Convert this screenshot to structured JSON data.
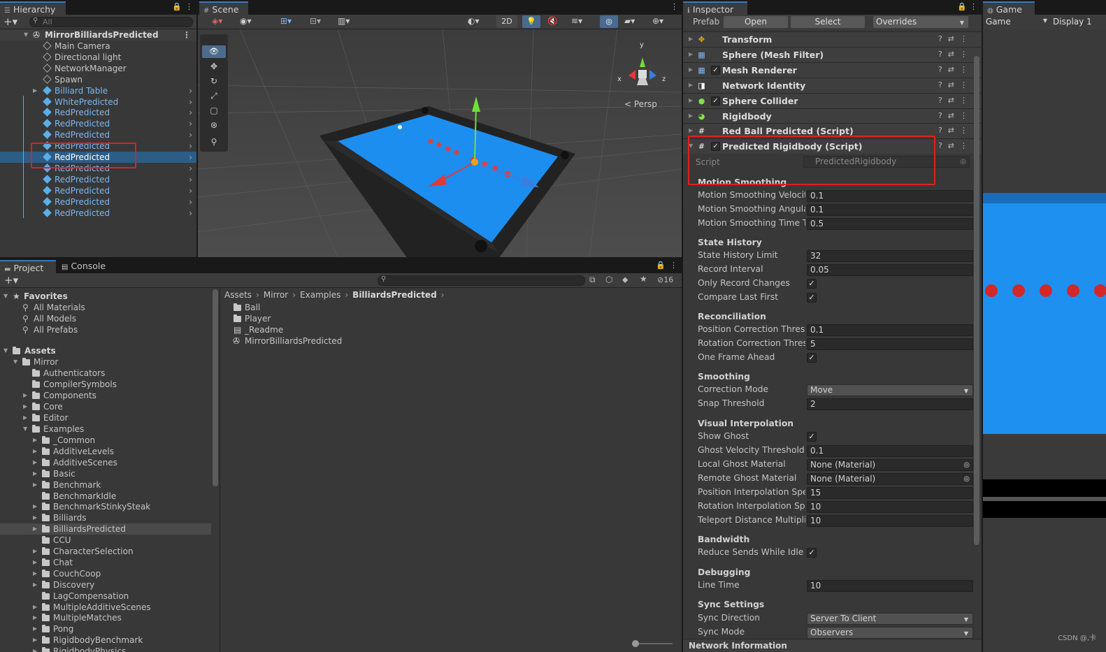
{
  "hierarchy": {
    "tab": "Hierarchy",
    "search_placeholder": "All",
    "root": "MirrorBilliardsPredicted",
    "items": [
      {
        "label": "Main Camera",
        "prefab": false
      },
      {
        "label": "Directional light",
        "prefab": false
      },
      {
        "label": "NetworkManager",
        "prefab": false
      },
      {
        "label": "Spawn",
        "prefab": false
      },
      {
        "label": "Billiard Table",
        "prefab": true
      },
      {
        "label": "WhitePredicted",
        "prefab": true
      },
      {
        "label": "RedPredicted",
        "prefab": true
      },
      {
        "label": "RedPredicted",
        "prefab": true
      },
      {
        "label": "RedPredicted",
        "prefab": true
      },
      {
        "label": "RedPredicted",
        "prefab": true
      },
      {
        "label": "RedPredicted",
        "prefab": true,
        "selected": true
      },
      {
        "label": "RedPredicted",
        "prefab": true
      },
      {
        "label": "RedPredicted",
        "prefab": true
      },
      {
        "label": "RedPredicted",
        "prefab": true
      },
      {
        "label": "RedPredicted",
        "prefab": true
      },
      {
        "label": "RedPredicted",
        "prefab": true
      }
    ]
  },
  "scene": {
    "tab": "Scene",
    "mode_2d": "2D",
    "persp": "Persp",
    "axis_x": "x",
    "axis_y": "y",
    "axis_z": "z"
  },
  "inspector": {
    "tab": "Inspector",
    "prefab_label": "Prefab",
    "open": "Open",
    "select": "Select",
    "overrides": "Overrides",
    "components": [
      {
        "name": "Transform",
        "checkbox": false,
        "icon": "transform-icon"
      },
      {
        "name": "Sphere (Mesh Filter)",
        "checkbox": false,
        "icon": "mesh-filter-icon"
      },
      {
        "name": "Mesh Renderer",
        "checkbox": true,
        "icon": "mesh-renderer-icon"
      },
      {
        "name": "Network Identity",
        "checkbox": false,
        "icon": "network-identity-icon"
      },
      {
        "name": "Sphere Collider",
        "checkbox": true,
        "icon": "sphere-collider-icon"
      },
      {
        "name": "Rigidbody",
        "checkbox": false,
        "icon": "rigidbody-icon"
      },
      {
        "name": "Red Ball Predicted (Script)",
        "checkbox": false,
        "icon": "script-icon"
      },
      {
        "name": "Predicted Rigidbody (Script)",
        "checkbox": true,
        "icon": "script-icon"
      }
    ],
    "script_label": "Script",
    "script_value": "PredictedRigidbody",
    "sections": [
      {
        "header": "Motion Smoothing",
        "fields": [
          {
            "label": "Motion Smoothing Velocity",
            "value": "0.1"
          },
          {
            "label": "Motion Smoothing Angular V",
            "value": "0.1"
          },
          {
            "label": "Motion Smoothing Time Tol",
            "value": "0.5"
          }
        ]
      },
      {
        "header": "State History",
        "fields": [
          {
            "label": "State History Limit",
            "value": "32"
          },
          {
            "label": "Record Interval",
            "value": "0.05"
          },
          {
            "label": "Only Record Changes",
            "check": true
          },
          {
            "label": "Compare Last First",
            "check": true
          }
        ]
      },
      {
        "header": "Reconciliation",
        "fields": [
          {
            "label": "Position Correction Thresho",
            "value": "0.1"
          },
          {
            "label": "Rotation Correction Thresho",
            "value": "5"
          },
          {
            "label": "One Frame Ahead",
            "check": true
          }
        ]
      },
      {
        "header": "Smoothing",
        "fields": [
          {
            "label": "Correction Mode",
            "value": "Move",
            "dropdown": true
          },
          {
            "label": "Snap Threshold",
            "value": "2"
          }
        ]
      },
      {
        "header": "Visual Interpolation",
        "fields": [
          {
            "label": "Show Ghost",
            "check": true
          },
          {
            "label": "Ghost Velocity Threshold",
            "value": "0.1"
          },
          {
            "label": "Local Ghost Material",
            "value": "None (Material)",
            "picker": true
          },
          {
            "label": "Remote Ghost Material",
            "value": "None (Material)",
            "picker": true
          },
          {
            "label": "Position Interpolation Speed",
            "value": "15"
          },
          {
            "label": "Rotation Interpolation Speed",
            "value": "10"
          },
          {
            "label": "Teleport Distance Multiplier",
            "value": "10"
          }
        ]
      },
      {
        "header": "Bandwidth",
        "fields": [
          {
            "label": "Reduce Sends While Idle",
            "check": true
          }
        ]
      },
      {
        "header": "Debugging",
        "fields": [
          {
            "label": "Line Time",
            "value": "10"
          }
        ]
      },
      {
        "header": "Sync Settings",
        "fields": [
          {
            "label": "Sync Direction",
            "value": "Server To Client",
            "dropdown": true
          },
          {
            "label": "Sync Mode",
            "value": "Observers",
            "dropdown": true
          }
        ]
      }
    ],
    "footer": "Network Information"
  },
  "game": {
    "tab": "Game",
    "mode": "Game",
    "display": "Display 1",
    "watermark": "CSDN @,卡"
  },
  "project": {
    "tab_project": "Project",
    "tab_console": "Console",
    "count": "16",
    "favorites": {
      "label": "Favorites",
      "items": [
        "All Materials",
        "All Models",
        "All Prefabs"
      ]
    },
    "assets_label": "Assets",
    "mirror_label": "Mirror",
    "mirror_children": [
      {
        "label": "Authenticators",
        "arrow": false
      },
      {
        "label": "CompilerSymbols",
        "arrow": false
      },
      {
        "label": "Components",
        "arrow": true
      },
      {
        "label": "Core",
        "arrow": true
      },
      {
        "label": "Editor",
        "arrow": true
      }
    ],
    "examples_label": "Examples",
    "examples": [
      {
        "label": "_Common",
        "arrow": true
      },
      {
        "label": "AdditiveLevels",
        "arrow": true
      },
      {
        "label": "AdditiveScenes",
        "arrow": true
      },
      {
        "label": "Basic",
        "arrow": true
      },
      {
        "label": "Benchmark",
        "arrow": true
      },
      {
        "label": "BenchmarkIdle",
        "arrow": false
      },
      {
        "label": "BenchmarkStinkySteak",
        "arrow": true
      },
      {
        "label": "Billiards",
        "arrow": true
      },
      {
        "label": "BilliardsPredicted",
        "arrow": true,
        "selected": true
      },
      {
        "label": "CCU",
        "arrow": false
      },
      {
        "label": "CharacterSelection",
        "arrow": true
      },
      {
        "label": "Chat",
        "arrow": true
      },
      {
        "label": "CouchCoop",
        "arrow": true
      },
      {
        "label": "Discovery",
        "arrow": true
      },
      {
        "label": "LagCompensation",
        "arrow": false
      },
      {
        "label": "MultipleAdditiveScenes",
        "arrow": true
      },
      {
        "label": "MultipleMatches",
        "arrow": true
      },
      {
        "label": "Pong",
        "arrow": true
      },
      {
        "label": "RigidbodyBenchmark",
        "arrow": true
      },
      {
        "label": "RigidbodyPhysics",
        "arrow": true
      }
    ],
    "breadcrumb": [
      "Assets",
      "Mirror",
      "Examples",
      "BilliardsPredicted"
    ],
    "files": [
      {
        "label": "Ball",
        "type": "folder"
      },
      {
        "label": "Player",
        "type": "folder"
      },
      {
        "label": "_Readme",
        "type": "doc"
      },
      {
        "label": "MirrorBilliardsPredicted",
        "type": "scene"
      }
    ]
  }
}
